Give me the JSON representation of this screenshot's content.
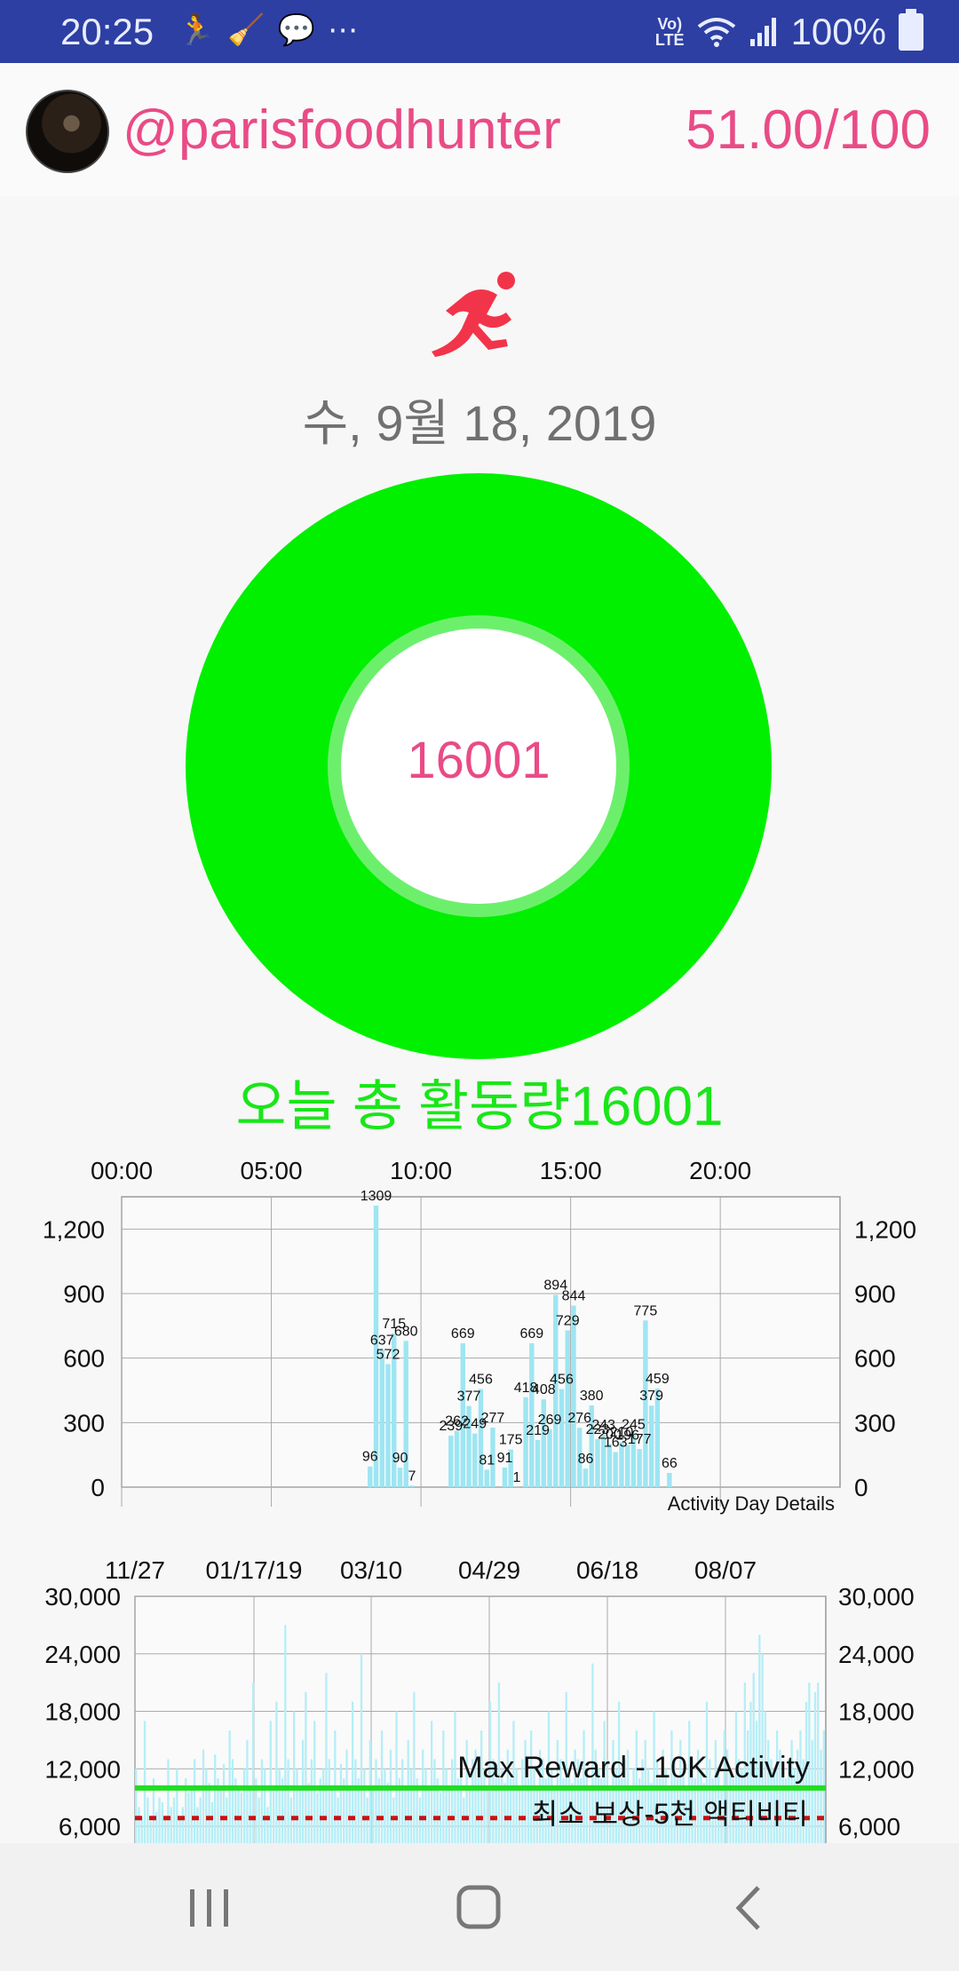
{
  "status_bar": {
    "time": "20:25",
    "network_label_top": "Vo)",
    "network_label_bottom": "LTE",
    "battery": "100%"
  },
  "header": {
    "username": "@parisfoodhunter",
    "score": "51.00/100"
  },
  "date": "수, 9월 18, 2019",
  "ring": {
    "value": "16001",
    "color_outer": "#00f000",
    "progress_fraction": 1.0
  },
  "total_label": "오늘 총 활동량16001",
  "day_chart": {
    "x_tick_labels": [
      "00:00",
      "05:00",
      "10:00",
      "15:00",
      "20:00"
    ],
    "y_tick_labels": [
      "0",
      "300",
      "600",
      "900",
      "1,200"
    ],
    "footer_label": "Activity Day Details"
  },
  "history_chart": {
    "x_tick_labels": [
      "11/27",
      "01/17/19",
      "03/10",
      "04/29",
      "06/18",
      "08/07"
    ],
    "y_tick_labels": [
      "6,000",
      "12,000",
      "18,000",
      "24,000",
      "30,000"
    ],
    "max_reward_label": "Max Reward - 10K Activity",
    "min_reward_label": "최소 보상-5천 액티비티",
    "max_reward_value": 10000,
    "min_reward_value": 5000,
    "max_line_color": "#22dd22",
    "min_line_color": "#cc1111"
  },
  "chart_data": [
    {
      "type": "bar",
      "x_unit": "hour",
      "xlim": [
        0,
        24
      ],
      "ylim": [
        0,
        1350
      ],
      "bar_color": "#9ee5f2",
      "bars": [
        {
          "x": 8.3,
          "y": 96,
          "label": "96"
        },
        {
          "x": 8.5,
          "y": 1309,
          "label": "1309"
        },
        {
          "x": 8.7,
          "y": 637,
          "label": "637"
        },
        {
          "x": 8.9,
          "y": 572,
          "label": "572"
        },
        {
          "x": 9.1,
          "y": 715,
          "label": "715"
        },
        {
          "x": 9.3,
          "y": 90,
          "label": "90"
        },
        {
          "x": 9.5,
          "y": 680,
          "label": "680"
        },
        {
          "x": 9.7,
          "y": 7,
          "label": "7"
        },
        {
          "x": 11.0,
          "y": 239,
          "label": "239"
        },
        {
          "x": 11.2,
          "y": 262,
          "label": "262"
        },
        {
          "x": 11.4,
          "y": 669,
          "label": "669"
        },
        {
          "x": 11.6,
          "y": 377,
          "label": "377"
        },
        {
          "x": 11.8,
          "y": 249,
          "label": "249"
        },
        {
          "x": 12.0,
          "y": 456,
          "label": "456"
        },
        {
          "x": 12.2,
          "y": 81,
          "label": "81"
        },
        {
          "x": 12.4,
          "y": 277,
          "label": "277"
        },
        {
          "x": 12.8,
          "y": 91,
          "label": "91"
        },
        {
          "x": 13.0,
          "y": 175,
          "label": "175"
        },
        {
          "x": 13.2,
          "y": 1,
          "label": "1"
        },
        {
          "x": 13.5,
          "y": 418,
          "label": "418"
        },
        {
          "x": 13.7,
          "y": 669,
          "label": "669"
        },
        {
          "x": 13.9,
          "y": 219,
          "label": "219"
        },
        {
          "x": 14.1,
          "y": 408,
          "label": "408"
        },
        {
          "x": 14.3,
          "y": 269,
          "label": "269"
        },
        {
          "x": 14.5,
          "y": 894,
          "label": "894"
        },
        {
          "x": 14.7,
          "y": 456,
          "label": "456"
        },
        {
          "x": 14.9,
          "y": 729,
          "label": "729"
        },
        {
          "x": 15.1,
          "y": 844,
          "label": "844"
        },
        {
          "x": 15.3,
          "y": 276,
          "label": "276"
        },
        {
          "x": 15.5,
          "y": 86,
          "label": "86"
        },
        {
          "x": 15.7,
          "y": 380,
          "label": "380"
        },
        {
          "x": 15.9,
          "y": 223,
          "label": "223"
        },
        {
          "x": 16.1,
          "y": 243,
          "label": "243"
        },
        {
          "x": 16.3,
          "y": 200,
          "label": "200"
        },
        {
          "x": 16.5,
          "y": 163,
          "label": "163"
        },
        {
          "x": 16.7,
          "y": 210,
          "label": "210"
        },
        {
          "x": 16.9,
          "y": 196,
          "label": "196"
        },
        {
          "x": 17.1,
          "y": 245,
          "label": "245"
        },
        {
          "x": 17.3,
          "y": 177,
          "label": "177"
        },
        {
          "x": 17.5,
          "y": 775,
          "label": "775"
        },
        {
          "x": 17.7,
          "y": 379,
          "label": "379"
        },
        {
          "x": 17.9,
          "y": 459,
          "label": "459"
        },
        {
          "x": 18.3,
          "y": 66,
          "label": "66"
        }
      ]
    },
    {
      "type": "bar",
      "x_unit": "day index",
      "ylim": [
        5000,
        30000
      ],
      "bar_color": "#b5eef7",
      "values": [
        12000,
        8000,
        7000,
        17000,
        9000,
        6500,
        11000,
        7500,
        9000,
        8500,
        7000,
        13000,
        8000,
        9000,
        12000,
        7000,
        8000,
        11000,
        9500,
        10000,
        13000,
        8000,
        9000,
        14000,
        12000,
        10500,
        8500,
        13500,
        11000,
        10000,
        12500,
        9000,
        16000,
        13000,
        11000,
        10000,
        9500,
        12000,
        15000,
        10000,
        21000,
        11000,
        9000,
        13000,
        12000,
        8000,
        17000,
        10000,
        19000,
        12000,
        11000,
        27000,
        13000,
        9000,
        18000,
        12000,
        10000,
        15000,
        20000,
        10500,
        13000,
        17000,
        9500,
        11000,
        12000,
        22000,
        13000,
        10000,
        16000,
        9000,
        12500,
        11000,
        14000,
        10000,
        19000,
        13000,
        11000,
        24000,
        12000,
        9000,
        15000,
        10000,
        13000,
        11000,
        16000,
        12000,
        10500,
        14000,
        9000,
        18000,
        11000,
        13000,
        10000,
        15000,
        12000,
        20000,
        11000,
        9000,
        14000,
        12000,
        10000,
        17000,
        13000,
        11000,
        9500,
        16000,
        12000,
        10000,
        13000,
        18000,
        11000,
        12000,
        9000,
        15000,
        10000,
        13000,
        14000,
        11000,
        16000,
        12000,
        10000,
        19000,
        13000,
        11000,
        21000,
        12000,
        10500,
        14000,
        11000,
        17000,
        12000,
        10000,
        13000,
        15000,
        11000,
        16000,
        12000,
        10000,
        14000,
        13000,
        11000,
        18000,
        12000,
        10000,
        15000,
        13000,
        11000,
        20000,
        12000,
        10500,
        14000,
        13000,
        11000,
        16000,
        12000,
        10000,
        23000,
        14000,
        12000,
        11000,
        17000,
        13000,
        10000,
        15000,
        12000,
        19000,
        11000,
        13000,
        14000,
        10000,
        12000,
        16000,
        11000,
        13000,
        15000,
        12000,
        10500,
        18000,
        13000,
        11000,
        14000,
        12000,
        10000,
        16000,
        13000,
        11000,
        15000,
        12000,
        10000,
        17000,
        13000,
        11000,
        14000,
        12000,
        10500,
        19000,
        13000,
        11000,
        15000,
        12000,
        10000,
        16000,
        14000,
        12000,
        11000,
        18000,
        13000,
        12000,
        21000,
        16000,
        19000,
        22000,
        17000,
        26000,
        24000,
        18000,
        15000,
        13000,
        12000,
        16000,
        14000,
        12000,
        11000,
        13000,
        15000,
        12000,
        14000,
        16000,
        13000,
        19000,
        21000,
        15000,
        20000,
        21000,
        14000,
        16000
      ]
    }
  ]
}
